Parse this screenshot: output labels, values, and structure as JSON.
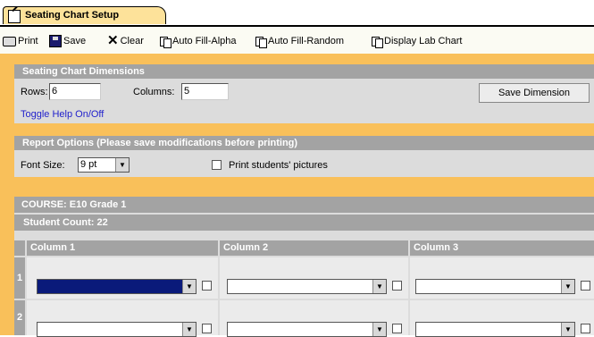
{
  "tab": {
    "label": "Seating Chart Setup"
  },
  "toolbar": {
    "print": "Print",
    "save": "Save",
    "clear": "Clear",
    "auto_fill_alpha": "Auto Fill-Alpha",
    "auto_fill_random": "Auto Fill-Random",
    "display_lab_chart": "Display Lab Chart"
  },
  "dimensions": {
    "title": "Seating Chart Dimensions",
    "rows_label": "Rows:",
    "rows_value": "6",
    "columns_label": "Columns:",
    "columns_value": "5",
    "save_button": "Save Dimension",
    "help_link": "Toggle Help On/Off"
  },
  "report": {
    "title": "Report Options (Please save modifications before printing)",
    "font_size_label": "Font Size:",
    "font_size_value": "9 pt",
    "print_pictures_label": "Print students' pictures"
  },
  "course": {
    "title": "COURSE: E10 Grade 1",
    "student_count": "Student Count: 22",
    "columns": [
      "Column 1",
      "Column 2",
      "Column 3"
    ],
    "rows": [
      "1",
      "2"
    ],
    "selected_cell_color": "#0a1a7a"
  },
  "colors": {
    "orange_bg": "#f9c05a",
    "panel_header": "#a3a3a3",
    "tab_bg": "#fde29a"
  }
}
